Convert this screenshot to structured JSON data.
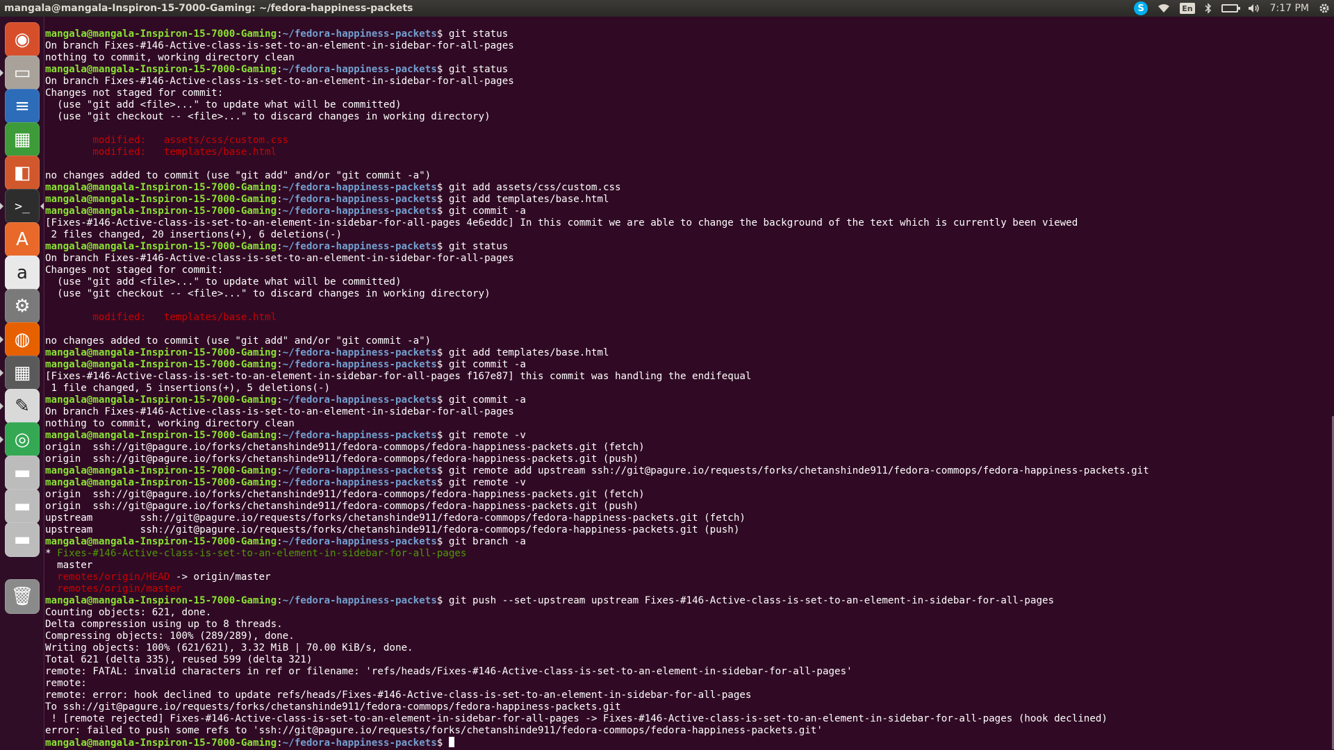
{
  "panel": {
    "title": "mangala@mangala-Inspiron-15-7000-Gaming: ~/fedora-happiness-packets",
    "skype": "S",
    "keyboard": "En",
    "time": "7:17 PM"
  },
  "icons": {
    "wifi": "wifi-icon",
    "bluetooth": "bluetooth-icon",
    "battery": "battery-icon",
    "volume": "volume-icon",
    "settings": "gear-icon"
  },
  "launcher": [
    {
      "name": "ubuntu-dash",
      "icon": "ubuntu-logo-icon",
      "glyph": "◉",
      "bg": "#d64f2a"
    },
    {
      "name": "files",
      "icon": "file-cabinet-icon",
      "glyph": "▭",
      "bg": "#a8a29a"
    },
    {
      "name": "libreoffice-writer",
      "icon": "writer-document-icon",
      "glyph": "≡",
      "bg": "#2c6cb8"
    },
    {
      "name": "libreoffice-calc",
      "icon": "calc-spreadsheet-icon",
      "glyph": "▦",
      "bg": "#3d9b3a"
    },
    {
      "name": "libreoffice-impress",
      "icon": "impress-presentation-icon",
      "glyph": "◧",
      "bg": "#d1582c"
    },
    {
      "name": "terminal",
      "icon": "terminal-icon",
      "glyph": ">_",
      "bg": "#2d2d2d"
    },
    {
      "name": "software-center",
      "icon": "shopping-bag-icon",
      "glyph": "A",
      "bg": "#e8692a"
    },
    {
      "name": "amazon",
      "icon": "amazon-icon",
      "glyph": "a",
      "bg": "#e9e9e9"
    },
    {
      "name": "system-settings",
      "icon": "wrench-gear-icon",
      "glyph": "⚙",
      "bg": "#7a7a7a"
    },
    {
      "name": "firefox",
      "icon": "firefox-icon",
      "glyph": "◍",
      "bg": "#e66000"
    },
    {
      "name": "calculator",
      "icon": "calculator-icon",
      "glyph": "▦",
      "bg": "#5a5a5a"
    },
    {
      "name": "text-editor",
      "icon": "text-editor-icon",
      "glyph": "✎",
      "bg": "#d9d9d9"
    },
    {
      "name": "chrome",
      "icon": "chrome-icon",
      "glyph": "◎",
      "bg": "#34a853"
    },
    {
      "name": "drive-1",
      "icon": "hard-drive-icon",
      "glyph": "▬",
      "bg": "#bcbcbc"
    },
    {
      "name": "drive-2",
      "icon": "hard-drive-icon",
      "glyph": "▬",
      "bg": "#bcbcbc"
    },
    {
      "name": "drive-3",
      "icon": "hard-drive-icon",
      "glyph": "▬",
      "bg": "#bcbcbc"
    },
    {
      "name": "trash",
      "icon": "trash-icon",
      "glyph": "🗑",
      "bg": "#8a8a8a"
    }
  ],
  "prompt": {
    "user": "mangala@mangala-Inspiron-15-7000-Gaming",
    "path": "~/fedora-happiness-packets",
    "sep": ":",
    "sym": "$ "
  },
  "lines": [
    {
      "t": "cmd",
      "s": "git status"
    },
    {
      "t": "out",
      "s": "On branch Fixes-#146-Active-class-is-set-to-an-element-in-sidebar-for-all-pages"
    },
    {
      "t": "out",
      "s": "nothing to commit, working directory clean"
    },
    {
      "t": "cmd",
      "s": "git status"
    },
    {
      "t": "out",
      "s": "On branch Fixes-#146-Active-class-is-set-to-an-element-in-sidebar-for-all-pages"
    },
    {
      "t": "out",
      "s": "Changes not staged for commit:"
    },
    {
      "t": "out",
      "s": "  (use \"git add <file>...\" to update what will be committed)"
    },
    {
      "t": "out",
      "s": "  (use \"git checkout -- <file>...\" to discard changes in working directory)"
    },
    {
      "t": "out",
      "s": ""
    },
    {
      "t": "red",
      "s": "\tmodified:   assets/css/custom.css"
    },
    {
      "t": "red",
      "s": "\tmodified:   templates/base.html"
    },
    {
      "t": "out",
      "s": ""
    },
    {
      "t": "out",
      "s": "no changes added to commit (use \"git add\" and/or \"git commit -a\")"
    },
    {
      "t": "cmd",
      "s": "git add assets/css/custom.css"
    },
    {
      "t": "cmd",
      "s": "git add templates/base.html"
    },
    {
      "t": "cmd",
      "s": "git commit -a"
    },
    {
      "t": "out",
      "s": "[Fixes-#146-Active-class-is-set-to-an-element-in-sidebar-for-all-pages 4e6eddc] In this commit we are able to change the background of the text which is currently been viewed"
    },
    {
      "t": "out",
      "s": " 2 files changed, 20 insertions(+), 6 deletions(-)"
    },
    {
      "t": "cmd",
      "s": "git status"
    },
    {
      "t": "out",
      "s": "On branch Fixes-#146-Active-class-is-set-to-an-element-in-sidebar-for-all-pages"
    },
    {
      "t": "out",
      "s": "Changes not staged for commit:"
    },
    {
      "t": "out",
      "s": "  (use \"git add <file>...\" to update what will be committed)"
    },
    {
      "t": "out",
      "s": "  (use \"git checkout -- <file>...\" to discard changes in working directory)"
    },
    {
      "t": "out",
      "s": ""
    },
    {
      "t": "red",
      "s": "\tmodified:   templates/base.html"
    },
    {
      "t": "out",
      "s": ""
    },
    {
      "t": "out",
      "s": "no changes added to commit (use \"git add\" and/or \"git commit -a\")"
    },
    {
      "t": "cmd",
      "s": "git add templates/base.html"
    },
    {
      "t": "cmd",
      "s": "git commit -a"
    },
    {
      "t": "out",
      "s": "[Fixes-#146-Active-class-is-set-to-an-element-in-sidebar-for-all-pages f167e87] this commit was handling the endifequal"
    },
    {
      "t": "out",
      "s": " 1 file changed, 5 insertions(+), 5 deletions(-)"
    },
    {
      "t": "cmd",
      "s": "git commit -a"
    },
    {
      "t": "out",
      "s": "On branch Fixes-#146-Active-class-is-set-to-an-element-in-sidebar-for-all-pages"
    },
    {
      "t": "out",
      "s": "nothing to commit, working directory clean"
    },
    {
      "t": "cmd",
      "s": "git remote -v"
    },
    {
      "t": "out",
      "s": "origin\tssh://git@pagure.io/forks/chetanshinde911/fedora-commops/fedora-happiness-packets.git (fetch)"
    },
    {
      "t": "out",
      "s": "origin\tssh://git@pagure.io/forks/chetanshinde911/fedora-commops/fedora-happiness-packets.git (push)"
    },
    {
      "t": "cmd",
      "s": "git remote add upstream ssh://git@pagure.io/requests/forks/chetanshinde911/fedora-commops/fedora-happiness-packets.git"
    },
    {
      "t": "cmd",
      "s": "git remote -v"
    },
    {
      "t": "out",
      "s": "origin\tssh://git@pagure.io/forks/chetanshinde911/fedora-commops/fedora-happiness-packets.git (fetch)"
    },
    {
      "t": "out",
      "s": "origin\tssh://git@pagure.io/forks/chetanshinde911/fedora-commops/fedora-happiness-packets.git (push)"
    },
    {
      "t": "out",
      "s": "upstream\tssh://git@pagure.io/requests/forks/chetanshinde911/fedora-commops/fedora-happiness-packets.git (fetch)"
    },
    {
      "t": "out",
      "s": "upstream\tssh://git@pagure.io/requests/forks/chetanshinde911/fedora-commops/fedora-happiness-packets.git (push)"
    },
    {
      "t": "cmd",
      "s": "git branch -a"
    },
    {
      "t": "cur",
      "s": "Fixes-#146-Active-class-is-set-to-an-element-in-sidebar-for-all-pages"
    },
    {
      "t": "out",
      "s": "  master"
    },
    {
      "t": "rem",
      "s": "remotes/origin/HEAD",
      "a": " -> origin/master"
    },
    {
      "t": "rem",
      "s": "remotes/origin/master",
      "a": ""
    },
    {
      "t": "cmd",
      "s": "git push --set-upstream upstream Fixes-#146-Active-class-is-set-to-an-element-in-sidebar-for-all-pages"
    },
    {
      "t": "out",
      "s": "Counting objects: 621, done."
    },
    {
      "t": "out",
      "s": "Delta compression using up to 8 threads."
    },
    {
      "t": "out",
      "s": "Compressing objects: 100% (289/289), done."
    },
    {
      "t": "out",
      "s": "Writing objects: 100% (621/621), 3.32 MiB | 70.00 KiB/s, done."
    },
    {
      "t": "out",
      "s": "Total 621 (delta 335), reused 599 (delta 321)"
    },
    {
      "t": "out",
      "s": "remote: FATAL: invalid characters in ref or filename: 'refs/heads/Fixes-#146-Active-class-is-set-to-an-element-in-sidebar-for-all-pages'"
    },
    {
      "t": "out",
      "s": "remote: "
    },
    {
      "t": "out",
      "s": "remote: error: hook declined to update refs/heads/Fixes-#146-Active-class-is-set-to-an-element-in-sidebar-for-all-pages"
    },
    {
      "t": "out",
      "s": "To ssh://git@pagure.io/requests/forks/chetanshinde911/fedora-commops/fedora-happiness-packets.git"
    },
    {
      "t": "out",
      "s": " ! [remote rejected] Fixes-#146-Active-class-is-set-to-an-element-in-sidebar-for-all-pages -> Fixes-#146-Active-class-is-set-to-an-element-in-sidebar-for-all-pages (hook declined)"
    },
    {
      "t": "out",
      "s": "error: failed to push some refs to 'ssh://git@pagure.io/requests/forks/chetanshinde911/fedora-commops/fedora-happiness-packets.git'"
    },
    {
      "t": "prompt",
      "s": ""
    }
  ]
}
